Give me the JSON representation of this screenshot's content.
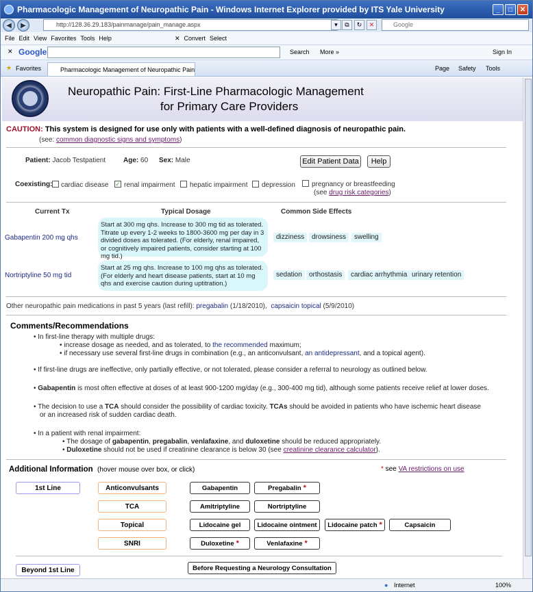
{
  "window": {
    "title": "Pharmacologic Management of Neuropathic Pain - Windows Internet Explorer provided by ITS Yale University"
  },
  "browser": {
    "url": "http://128.36.29.183/painmanage/pain_manage.aspx",
    "search_placeholder": "Google",
    "menu": [
      "File",
      "Edit",
      "View",
      "Favorites",
      "Tools",
      "Help"
    ],
    "convert": "Convert",
    "select": "Select",
    "google_label": "Google",
    "search_btn": "Search",
    "more_btn": "More »",
    "sign_in": "Sign In",
    "favorites": "Favorites",
    "tab_title": "Pharmacologic Management of Neuropathic Pain",
    "page_menu": "Page",
    "safety_menu": "Safety",
    "tools_menu": "Tools",
    "status_zone": "Internet",
    "zoom": "100%"
  },
  "page": {
    "heading_line1": "Neuropathic Pain: First-Line Pharmacologic Management",
    "heading_line2": "for Primary Care Providers",
    "caution_label": "CAUTION:",
    "caution_text": " This system is designed for use only with patients with a well-defined diagnosis of neuropathic pain.",
    "see_prefix": "(see: ",
    "see_link": "common diagnostic signs and symptoms",
    "see_suffix": ")",
    "patient_label": "Patient:",
    "patient_name": "Jacob Testpatient",
    "age_label": "Age:",
    "age_value": "60",
    "sex_label": "Sex:",
    "sex_value": "Male",
    "edit_btn": "Edit Patient Data",
    "help_btn": "Help",
    "coexisting_label": "Coexisting:",
    "conditions": [
      {
        "label": "cardiac disease",
        "checked": false
      },
      {
        "label": "renal impairment",
        "checked": true
      },
      {
        "label": "hepatic impairment",
        "checked": false
      },
      {
        "label": "depression",
        "checked": false
      },
      {
        "label": "pregnancy or breastfeeding",
        "checked": false
      }
    ],
    "drug_risk_prefix": "(see ",
    "drug_risk_link": "drug risk categories",
    "drug_risk_suffix": ")",
    "col_current": "Current Tx",
    "col_dosage": "Typical Dosage",
    "col_side": "Common Side Effects",
    "meds": [
      {
        "name": "Gabapentin 200 mg qhs",
        "dosage": "Start at 300 mg qhs. Increase to 300 mg tid as tolerated. Titrate up every 1-2 weeks to 1800-3600 mg per day in 3 divided doses as tolerated. (For elderly, renal impaired, or cognitively impaired patients, consider starting at 100 mg tid.)",
        "side_effects": [
          "dizziness",
          "drowsiness",
          "swelling"
        ]
      },
      {
        "name": "Nortriptyline 50 mg tid",
        "dosage": "Start at 25 mg qhs. Increase to 100 mg qhs as tolerated. (For elderly and heart disease patients, start at 10 mg qhs and exercise caution during uptitration.)",
        "side_effects": [
          "sedation",
          "orthostasis",
          "cardiac arrhythmia",
          "urinary retention"
        ]
      }
    ],
    "other_label": "Other neuropathic pain medications in past 5 years (last refill):",
    "other1_name": "pregabalin",
    "other1_date": "(1/18/2010),",
    "other2_name": "capsaicin topical",
    "other2_date": "(5/9/2010)",
    "comments_title": "Comments/Recommendations",
    "c1_intro": "In first-line therapy with multiple drugs:",
    "c1_a1": "increase dosage as needed, and as tolerated, to ",
    "c1_a2": "the recommended",
    "c1_a3": " maximum;",
    "c1_b1": "if necessary use several first-line drugs in combination (e.g., an anticonvulsant, ",
    "c1_b2": "an antidepressant",
    "c1_b3": ", and a topical agent).",
    "c2": "If first-line drugs are ineffective, only partially effective, or not tolerated, please consider a referral to neurology as outlined below.",
    "c3_bold": "Gabapentin",
    "c3_rest": " is most often effective at doses of at least 900-1200 mg/day (e.g., 300-400 mg tid), although some patients receive relief at lower doses.",
    "c4_a": "The decision to use a ",
    "c4_b": "TCA",
    "c4_c": " should consider the possibility of cardiac toxicity. ",
    "c4_d": "TCAs",
    "c4_e": " should be avoided in patients who have ischemic heart disease or an increased risk of sudden cardiac death.",
    "c5_intro": "In a patient with renal impairment:",
    "c5_a1": "The dosage of ",
    "c5_a2": "gabapentin",
    "c5_a3": ", ",
    "c5_a4": "pregabalin",
    "c5_a5": ", ",
    "c5_a6": "venlafaxine",
    "c5_a7": ", and ",
    "c5_a8": "duloxetine",
    "c5_a9": " should be reduced appropriately.",
    "c5_b1": "Duloxetine",
    "c5_b2": " should not be used if creatinine clearance is below 30 (see ",
    "c5_b3": "creatinine clearance calculator",
    "c5_b4": ").",
    "addinfo_title": "Additional Information",
    "addinfo_hint": "(hover mouse over box, or click)",
    "va_star": "*",
    "va_see": " see ",
    "va_link": "VA restrictions on use",
    "line1": "1st Line",
    "beyond": "Beyond 1st Line",
    "neuro_consult": "Before Requesting a Neurology Consultation",
    "classes": [
      {
        "name": "Anticonvulsants",
        "drugs": [
          {
            "n": "Gabapentin",
            "star": ""
          },
          {
            "n": "Pregabalin",
            "star": "*"
          }
        ]
      },
      {
        "name": "TCA",
        "drugs": [
          {
            "n": "Amitriptyline",
            "star": ""
          },
          {
            "n": "Nortriptyline",
            "star": ""
          }
        ]
      },
      {
        "name": "Topical",
        "drugs": [
          {
            "n": "Lidocaine gel",
            "star": ""
          },
          {
            "n": "Lidocaine ointment",
            "star": ""
          },
          {
            "n": "Lidocaine patch",
            "star": "*"
          },
          {
            "n": "Capsaicin",
            "star": ""
          }
        ]
      },
      {
        "name": "SNRI",
        "drugs": [
          {
            "n": "Duloxetine",
            "star": "*"
          },
          {
            "n": "Venlafaxine",
            "star": "*"
          }
        ]
      }
    ]
  },
  "colors": {
    "caution": "#a0142a",
    "med_link": "#1c2a80",
    "dose_bg": "#d9f7fb",
    "class_border": "#f4b27a",
    "line_border": "#9a9af0"
  }
}
